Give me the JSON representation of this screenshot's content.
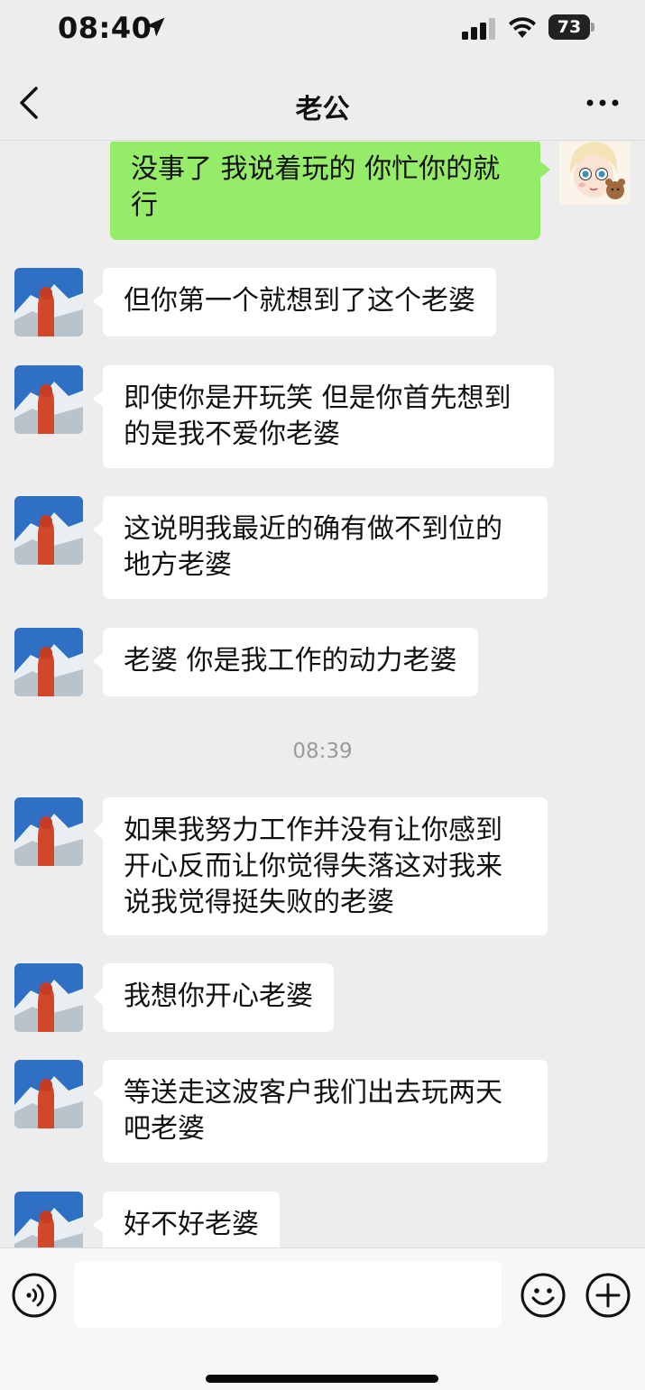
{
  "status_bar": {
    "time": "08:40",
    "battery": "73",
    "location_icon": "location-arrow-icon",
    "signal_icon": "cellular-signal-icon",
    "wifi_icon": "wifi-icon"
  },
  "header": {
    "back_icon": "chevron-left-icon",
    "title": "老公",
    "more_icon": "more-dots-icon"
  },
  "colors": {
    "background": "#ededed",
    "outgoing_bubble": "#95ec69",
    "incoming_bubble": "#ffffff",
    "timestamp_text": "#9b9b9b"
  },
  "messages": [
    {
      "sender": "me",
      "text": "没事了 我说着玩的 你忙你的就行"
    },
    {
      "sender": "contact",
      "text": "但你第一个就想到了这个老婆"
    },
    {
      "sender": "contact",
      "text": "即使你是开玩笑 但是你首先想到的是我不爱你老婆"
    },
    {
      "sender": "contact",
      "text": "这说明我最近的确有做不到位的地方老婆"
    },
    {
      "sender": "contact",
      "text": "老婆 你是我工作的动力老婆"
    },
    {
      "sender": "contact",
      "text": "如果我努力工作并没有让你感到开心反而让你觉得失落这对我来说我觉得挺失败的老婆"
    },
    {
      "sender": "contact",
      "text": "我想你开心老婆"
    },
    {
      "sender": "contact",
      "text": "等送走这波客户我们出去玩两天吧老婆"
    },
    {
      "sender": "contact",
      "text": "好不好老婆"
    }
  ],
  "timestamp": "08:39",
  "input_bar": {
    "voice_icon": "voice-icon",
    "input_value": "",
    "emoji_icon": "emoji-icon",
    "plus_icon": "plus-icon"
  }
}
